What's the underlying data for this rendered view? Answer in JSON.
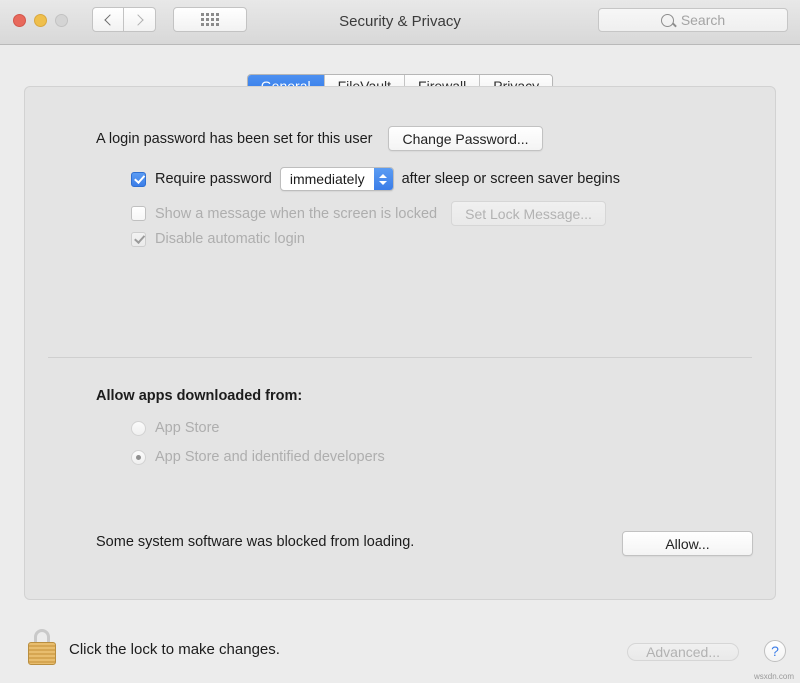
{
  "window": {
    "title": "Security & Privacy",
    "traffic_lights": [
      "close",
      "minimize",
      "zoom"
    ],
    "nav": {
      "back": "‹",
      "forward": "›"
    },
    "grid_button_label": "show-all",
    "search": {
      "placeholder": "Search",
      "value": ""
    }
  },
  "tabs": [
    {
      "label": "General",
      "active": true
    },
    {
      "label": "FileVault",
      "active": false
    },
    {
      "label": "Firewall",
      "active": false
    },
    {
      "label": "Privacy",
      "active": false
    }
  ],
  "general": {
    "password_status": "A login password has been set for this user",
    "change_password_button": "Change Password...",
    "require_password": {
      "label": "Require password",
      "checked": true,
      "delay_value": "immediately",
      "suffix": "after sleep or screen saver begins"
    },
    "show_message": {
      "label": "Show a message when the screen is locked",
      "checked": false,
      "button": "Set Lock Message...",
      "button_disabled": true
    },
    "disable_auto_login": {
      "label": "Disable automatic login",
      "checked": true,
      "disabled": true
    },
    "allow_apps": {
      "heading": "Allow apps downloaded from:",
      "options": [
        {
          "label": "App Store",
          "selected": false
        },
        {
          "label": "App Store and identified developers",
          "selected": true
        }
      ]
    },
    "blocked_software": {
      "message": "Some system software was blocked from loading.",
      "button": "Allow..."
    }
  },
  "footer": {
    "lock_icon": "padlock-closed",
    "lock_text": "Click the lock to make changes.",
    "advanced_button": "Advanced...",
    "advanced_disabled": true,
    "help_button": "?"
  },
  "watermark": "wsxdn.com",
  "colors": {
    "accent_blue": "#3b7de8",
    "window_bg": "#ececec",
    "panel_bg": "#e4e4e4",
    "lock_gold": "#d6a652"
  }
}
